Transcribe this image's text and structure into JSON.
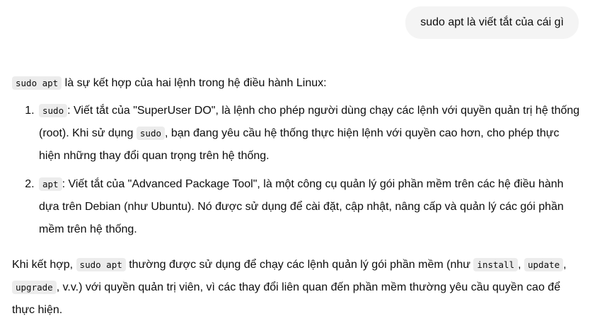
{
  "user_message": "sudo apt là viết tắt của cái gì",
  "reply": {
    "intro": {
      "code": "sudo apt",
      "text": " là sự kết hợp của hai lệnh trong hệ điều hành Linux:"
    },
    "items": [
      {
        "code": "sudo",
        "text_a": ": Viết tắt của \"SuperUser DO\", là lệnh cho phép người dùng chạy các lệnh với quyền quản trị hệ thống (root). Khi sử dụng ",
        "code_b": "sudo",
        "text_b": ", bạn đang yêu cầu hệ thống thực hiện lệnh với quyền cao hơn, cho phép thực hiện những thay đổi quan trọng trên hệ thống."
      },
      {
        "code": "apt",
        "text_a": ": Viết tắt của \"Advanced Package Tool\", là một công cụ quản lý gói phần mềm trên các hệ điều hành dựa trên Debian (như Ubuntu). Nó được sử dụng để cài đặt, cập nhật, nâng cấp và quản lý các gói phần mềm trên hệ thống."
      }
    ],
    "closing": {
      "text_a": "Khi kết hợp, ",
      "code_a": "sudo apt",
      "text_b": " thường được sử dụng để chạy các lệnh quản lý gói phần mềm (như ",
      "code_b": "install",
      "text_c": ", ",
      "code_c": "update",
      "text_d": ", ",
      "code_d": "upgrade",
      "text_e": ", v.v.) với quyền quản trị viên, vì các thay đổi liên quan đến phần mềm thường yêu cầu quyền cao để thực hiện."
    }
  }
}
